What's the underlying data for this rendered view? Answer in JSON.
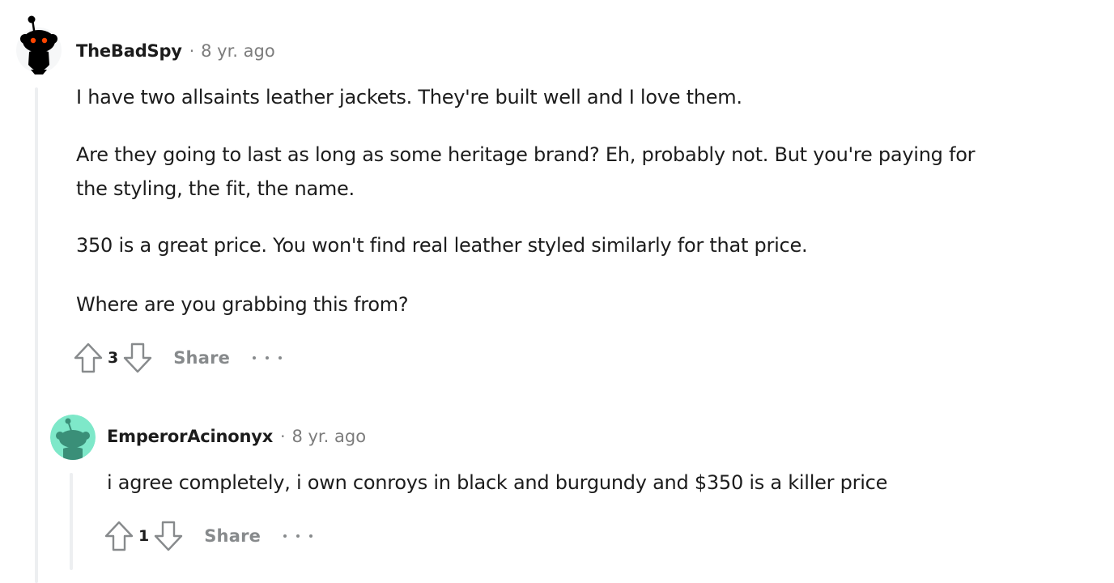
{
  "comments": [
    {
      "username": "TheBadSpy",
      "separator": "·",
      "timestamp": "8 yr. ago",
      "paragraphs": [
        "I have two allsaints leather jackets. They're built well and I love them.",
        "Are they going to last as long as some heritage brand? Eh, probably not. But you're paying for",
        "the styling, the fit, the name.",
        "350 is a great price. You won't find real leather styled similarly for that price.",
        "Where are you grabbing this from?"
      ],
      "score": "3",
      "share_label": "Share",
      "avatar_color": "#f6f7f8"
    },
    {
      "username": "EmperorAcinonyx",
      "separator": "·",
      "timestamp": "8 yr. ago",
      "paragraphs": [
        "i agree completely, i own conroys in black and burgundy and $350 is a killer price"
      ],
      "score": "1",
      "share_label": "Share",
      "avatar_color": "#7ee8c9"
    }
  ],
  "colors": {
    "text": "#1c1c1c",
    "meta": "#7c7c7c",
    "action": "#878a8c",
    "thread_line": "#edeff1"
  },
  "icons": [
    "upvote-icon",
    "downvote-icon",
    "more-options-icon",
    "snoo-avatar-icon"
  ]
}
